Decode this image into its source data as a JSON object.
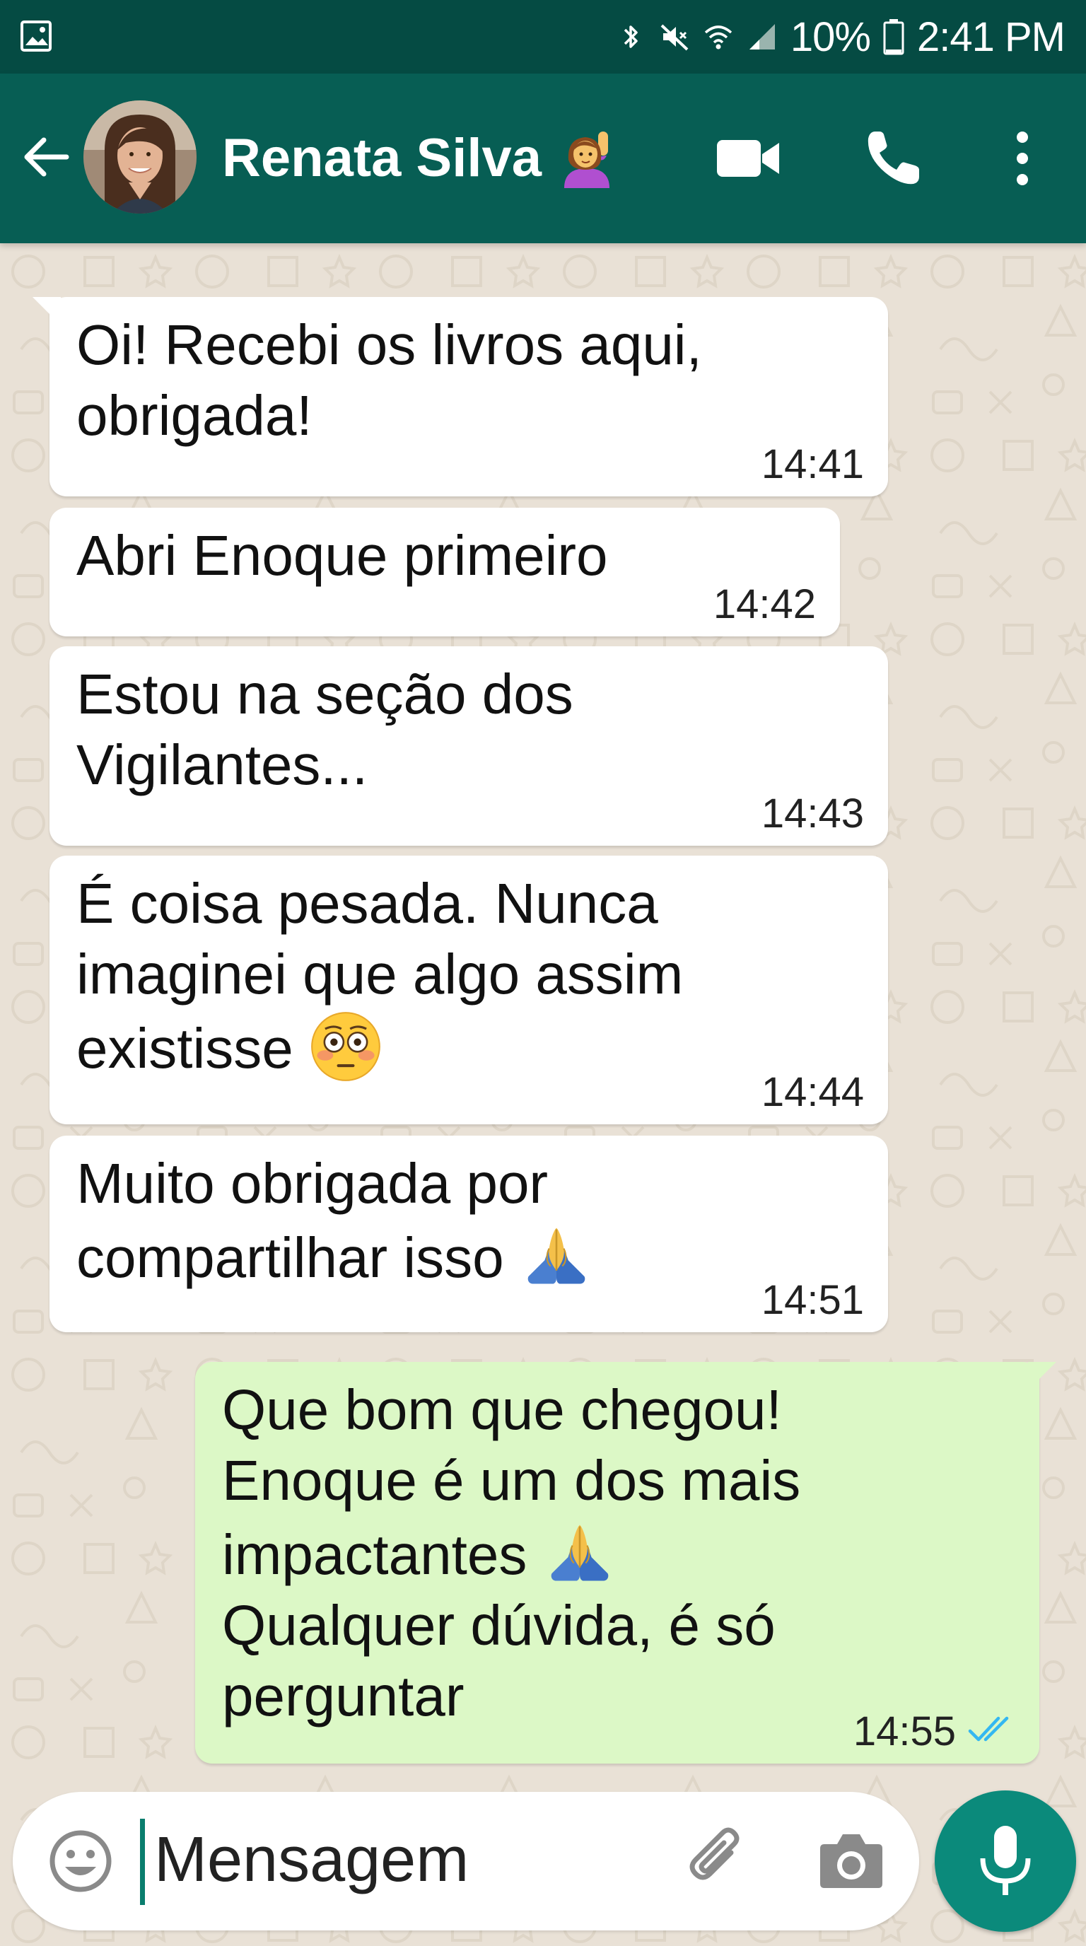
{
  "status_bar": {
    "battery_percent": "10%",
    "time": "2:41 PM",
    "icons": [
      "gallery-icon",
      "bluetooth-icon",
      "mute-icon",
      "wifi-icon",
      "signal-icon",
      "battery-icon"
    ]
  },
  "header": {
    "contact_name": "Renata Silva",
    "name_emoji": "person-raising-hand-emoji",
    "icons": [
      "back-arrow-icon",
      "avatar",
      "video-call-icon",
      "phone-icon",
      "more-options-icon"
    ]
  },
  "messages": [
    {
      "direction": "incoming",
      "text": "Oi! Recebi os livros aqui,\nobrigada!",
      "time": "14:41"
    },
    {
      "direction": "incoming",
      "text": "Abri Enoque primeiro",
      "time": "14:42"
    },
    {
      "direction": "incoming",
      "text": "Estou na seção dos\nVigilantes...",
      "time": "14:43"
    },
    {
      "direction": "incoming",
      "text": "É coisa pesada. Nunca\nimaginei que algo assim\nexistisse",
      "emoji": "flushed-face-emoji",
      "time": "14:44"
    },
    {
      "direction": "incoming",
      "text": "Muito obrigada por\ncompartilhar isso",
      "emoji": "folded-hands-emoji",
      "time": "14:51"
    },
    {
      "direction": "outgoing",
      "text_before_emoji": "Que bom que chegou!\nEnoque é um dos mais\nimpactantes",
      "emoji": "folded-hands-emoji",
      "text_after_emoji": "Qualquer dúvida, é só\nperguntar",
      "time": "14:55",
      "status": "read-double-check"
    }
  ],
  "composer": {
    "placeholder": "Mensagem",
    "icons": [
      "emoji-icon",
      "attach-icon",
      "camera-icon",
      "mic-icon"
    ]
  },
  "colors": {
    "status_bar": "#054b43",
    "header": "#075e54",
    "chat_bg": "#e9e1d6",
    "incoming_bubble": "#ffffff",
    "outgoing_bubble": "#dcf8c6",
    "mic_button": "#0b8a7b",
    "read_ticks": "#34b7f1"
  }
}
